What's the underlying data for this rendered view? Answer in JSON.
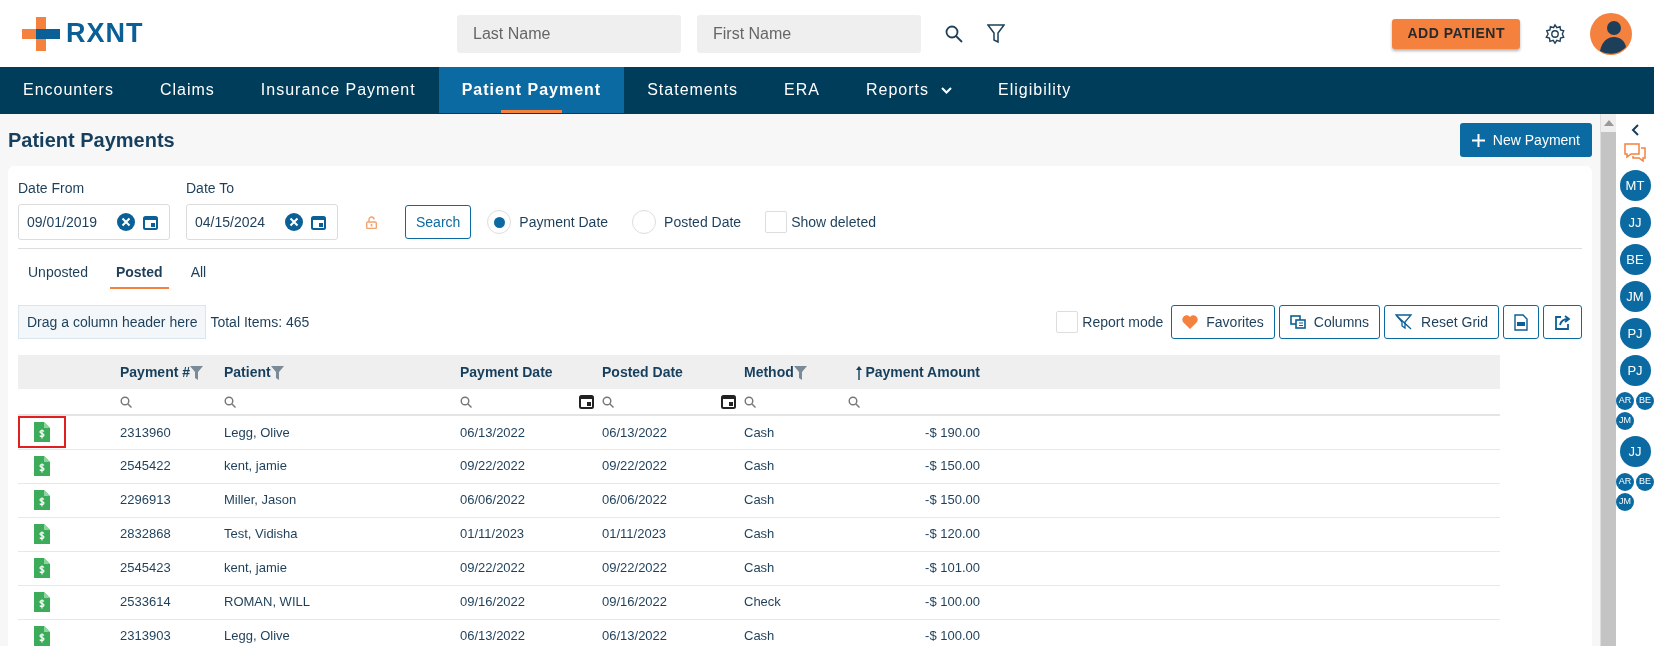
{
  "header": {
    "logo": "RXNT",
    "search": [
      {
        "placeholder": "Last Name"
      },
      {
        "placeholder": "First Name"
      }
    ],
    "add_button": "ADD PATIENT"
  },
  "nav": [
    {
      "label": "Encounters",
      "selected": false
    },
    {
      "label": "Claims",
      "selected": false
    },
    {
      "label": "Insurance Payment",
      "selected": false
    },
    {
      "label": "Patient Payment",
      "selected": true
    },
    {
      "label": "Statements",
      "selected": false
    },
    {
      "label": "ERA",
      "selected": false
    },
    {
      "label": "Reports",
      "selected": false,
      "dropdown": true
    },
    {
      "label": "Eligibility",
      "selected": false
    }
  ],
  "page": {
    "title": "Patient Payments",
    "new_button": "New Payment"
  },
  "filters": {
    "date_from": {
      "label": "Date From",
      "value": "09/01/2019"
    },
    "date_to": {
      "label": "Date To",
      "value": "04/15/2024"
    },
    "search_button": "Search",
    "radios": [
      {
        "label": "Payment Date",
        "selected": true
      },
      {
        "label": "Posted Date",
        "selected": false
      }
    ],
    "show_deleted": {
      "label": "Show deleted",
      "checked": false
    }
  },
  "subtabs": [
    {
      "label": "Unposted",
      "selected": false
    },
    {
      "label": "Posted",
      "selected": true
    },
    {
      "label": "All",
      "selected": false
    }
  ],
  "toolbar": {
    "group_zone": "Drag a column header here",
    "total": "Total Items: 465",
    "report_mode": {
      "label": "Report mode",
      "checked": false
    },
    "buttons": [
      {
        "label": "Favorites",
        "kind": "favorites"
      },
      {
        "label": "Columns",
        "kind": "columns"
      },
      {
        "label": "Reset Grid",
        "kind": "reset"
      },
      {
        "kind": "pdf"
      },
      {
        "kind": "export"
      }
    ]
  },
  "table": {
    "columns": [
      {
        "label": "Payment #",
        "filter": true,
        "sort": false,
        "date": false
      },
      {
        "label": "Patient",
        "filter": true,
        "sort": false,
        "date": false
      },
      {
        "label": "Payment Date",
        "filter": false,
        "sort": false,
        "date": true
      },
      {
        "label": "Posted Date",
        "filter": false,
        "sort": false,
        "date": true
      },
      {
        "label": "Method",
        "filter": true,
        "sort": false,
        "date": false
      },
      {
        "label": "Payment Amount",
        "filter": false,
        "sort": true,
        "date": false
      }
    ],
    "rows": [
      {
        "highlighted": true,
        "cells": [
          "2313960",
          "Legg, Olive",
          "06/13/2022",
          "06/13/2022",
          "Cash",
          "-$ 190.00"
        ]
      },
      {
        "highlighted": false,
        "cells": [
          "2545422",
          "kent, jamie",
          "09/22/2022",
          "09/22/2022",
          "Cash",
          "-$ 150.00"
        ]
      },
      {
        "highlighted": false,
        "cells": [
          "2296913",
          "Miller, Jason",
          "06/06/2022",
          "06/06/2022",
          "Cash",
          "-$ 150.00"
        ]
      },
      {
        "highlighted": false,
        "cells": [
          "2832868",
          "Test, Vidisha",
          "01/11/2023",
          "01/11/2023",
          "Cash",
          "-$ 120.00"
        ]
      },
      {
        "highlighted": false,
        "cells": [
          "2545423",
          "kent, jamie",
          "09/22/2022",
          "09/22/2022",
          "Cash",
          "-$ 101.00"
        ]
      },
      {
        "highlighted": false,
        "cells": [
          "2533614",
          "ROMAN, WILL",
          "09/16/2022",
          "09/16/2022",
          "Check",
          "-$ 100.00"
        ]
      },
      {
        "highlighted": false,
        "cells": [
          "2313903",
          "Legg, Olive",
          "06/13/2022",
          "06/13/2022",
          "Cash",
          "-$ 100.00"
        ]
      }
    ]
  },
  "side_panel": {
    "avatars": [
      {
        "kind": "single",
        "initials": [
          "MT"
        ]
      },
      {
        "kind": "single",
        "initials": [
          "JJ"
        ]
      },
      {
        "kind": "single",
        "initials": [
          "BE"
        ]
      },
      {
        "kind": "single",
        "initials": [
          "JM"
        ]
      },
      {
        "kind": "single",
        "initials": [
          "PJ"
        ]
      },
      {
        "kind": "single",
        "initials": [
          "PJ"
        ]
      },
      {
        "kind": "group",
        "initials": [
          "AR",
          "BE",
          "JM"
        ]
      },
      {
        "kind": "single",
        "initials": [
          "JJ"
        ]
      },
      {
        "kind": "group",
        "initials": [
          "AR",
          "BE",
          "JM"
        ]
      }
    ]
  }
}
